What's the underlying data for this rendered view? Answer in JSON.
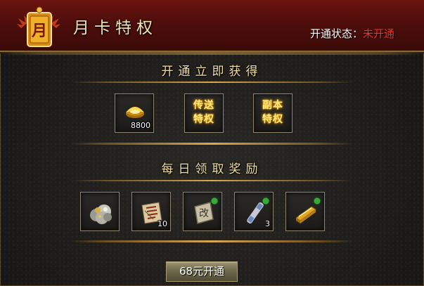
{
  "header": {
    "badge_char": "月",
    "title": "月卡特权",
    "status_label": "开通状态：",
    "status_value": "未开通"
  },
  "sections": {
    "instant": {
      "title": "开通立即获得"
    },
    "daily": {
      "title": "每日领取奖励"
    }
  },
  "instant_rewards": [
    {
      "icon": "gold-ingot-icon",
      "qty": "8800"
    },
    {
      "icon": "teleport-privilege-icon",
      "text_line1": "传送",
      "text_line2": "特权"
    },
    {
      "icon": "dungeon-privilege-icon",
      "text_line1": "副本",
      "text_line2": "特权"
    }
  ],
  "daily_rewards": [
    {
      "icon": "silver-ore-pile-icon",
      "qty": ""
    },
    {
      "icon": "scroll-document-icon",
      "qty": "10"
    },
    {
      "icon": "stone-tablet-icon",
      "tablet_char": "改",
      "qty": ""
    },
    {
      "icon": "jade-scroll-icon",
      "qty": "3"
    },
    {
      "icon": "gold-bar-icon",
      "qty": ""
    }
  ],
  "purchase_button": {
    "label": "68元开通"
  },
  "colors": {
    "header_red": "#4e0e0b",
    "status_off": "#ff2b1e",
    "gold_text": "#f2dfa4"
  }
}
